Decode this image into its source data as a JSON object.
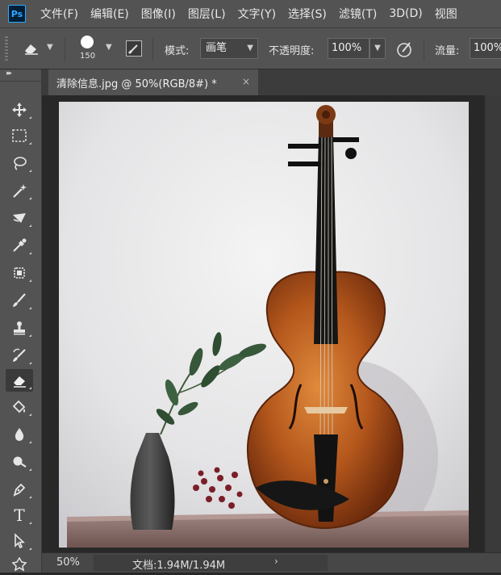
{
  "app": {
    "logo": "Ps"
  },
  "menu": [
    "文件(F)",
    "编辑(E)",
    "图像(I)",
    "图层(L)",
    "文字(Y)",
    "选择(S)",
    "滤镜(T)",
    "3D(D)",
    "视图"
  ],
  "options": {
    "tool_icon": "eraser-icon",
    "brush_size": "150",
    "mode_label": "模式:",
    "mode_value": "画笔",
    "opacity_label": "不透明度:",
    "opacity_value": "100%",
    "flow_label": "流量:",
    "flow_value": "100%"
  },
  "tools": [
    {
      "name": "move-tool",
      "icon": "move-icon"
    },
    {
      "name": "marquee-tool",
      "icon": "rect-marquee-icon"
    },
    {
      "name": "lasso-tool",
      "icon": "lasso-icon"
    },
    {
      "name": "magic-wand-tool",
      "icon": "magic-wand-icon"
    },
    {
      "name": "crop-tool",
      "icon": "crop-icon"
    },
    {
      "name": "eyedropper-tool",
      "icon": "eyedropper-icon"
    },
    {
      "name": "healing-brush-tool",
      "icon": "bandage-icon"
    },
    {
      "name": "brush-tool",
      "icon": "brush-icon"
    },
    {
      "name": "clone-stamp-tool",
      "icon": "stamp-icon"
    },
    {
      "name": "history-brush-tool",
      "icon": "history-brush-icon"
    },
    {
      "name": "eraser-tool",
      "icon": "eraser-icon",
      "active": true
    },
    {
      "name": "paint-bucket-tool",
      "icon": "paint-bucket-icon"
    },
    {
      "name": "blur-tool",
      "icon": "blur-drop-icon"
    },
    {
      "name": "dodge-tool",
      "icon": "dodge-icon"
    },
    {
      "name": "pen-tool",
      "icon": "pen-icon"
    },
    {
      "name": "type-tool",
      "icon": "type-icon",
      "glyph": "T"
    },
    {
      "name": "path-selection-tool",
      "icon": "arrow-select-icon"
    },
    {
      "name": "custom-shape-tool",
      "icon": "shape-icon"
    }
  ],
  "document": {
    "tab_title": "清除信息.jpg @ 50%(RGB/8#) *",
    "close_glyph": "×"
  },
  "status": {
    "zoom": "50%",
    "doc_info": "文档:1.94M/1.94M",
    "arrow": "›"
  },
  "colors": {
    "ui_panel": "#535353",
    "ui_dark": "#282828",
    "ps_blue": "#31a8ff",
    "violin": "#b4571c",
    "table": "#8a6c64"
  }
}
